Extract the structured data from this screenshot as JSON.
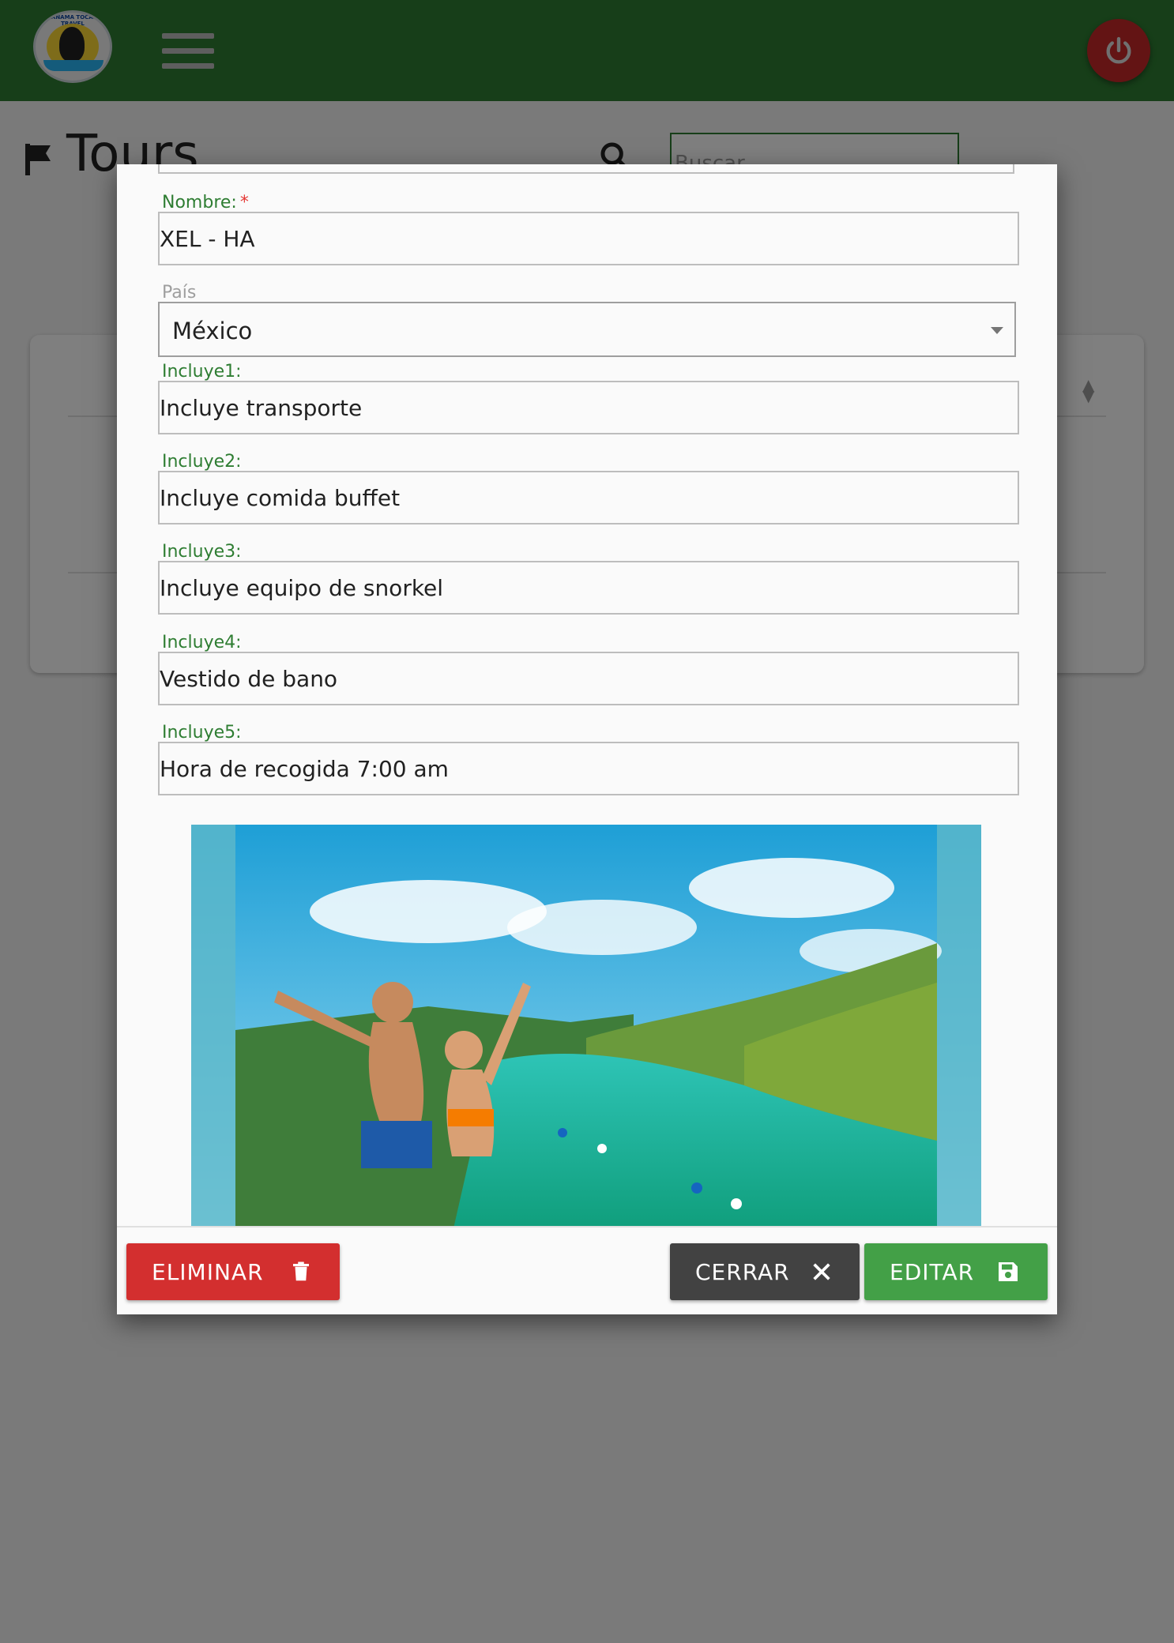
{
  "header": {
    "logo_text": "PANAMA TOCAN TRAVEL",
    "menu_icon": "hamburger-icon",
    "power_icon": "power-icon"
  },
  "page": {
    "title": "Tours",
    "title_icon": "flag-icon",
    "search_placeholder": "Buscar"
  },
  "modal": {
    "nombre": {
      "label": "Nombre:",
      "required_mark": "*",
      "value": "XEL - HA"
    },
    "pais": {
      "label": "País",
      "value": "México"
    },
    "incluye": [
      {
        "label": "Incluye1:",
        "value": "Incluye transporte"
      },
      {
        "label": "Incluye2:",
        "value": "Incluye comida buffet"
      },
      {
        "label": "Incluye3:",
        "value": "Incluye equipo de snorkel"
      },
      {
        "label": "Incluye4:",
        "value": "Vestido de bano"
      },
      {
        "label": "Incluye5:",
        "value": "Hora de recogida 7:00 am"
      }
    ],
    "image_alt": "tour-photo",
    "footer": {
      "delete_label": "ELIMINAR",
      "close_label": "CERRAR",
      "edit_label": "EDITAR"
    }
  },
  "colors": {
    "topbar": "#2e7d32",
    "accent_green": "#2e7d32",
    "delete_red": "#d32f2f",
    "close_dark": "#424242",
    "edit_green": "#43a047",
    "power_red": "#c62828"
  }
}
